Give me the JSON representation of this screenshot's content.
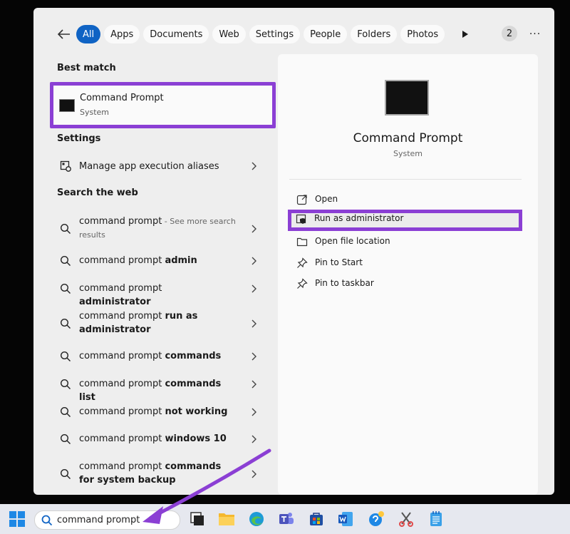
{
  "tabs": [
    "All",
    "Apps",
    "Documents",
    "Web",
    "Settings",
    "People",
    "Folders",
    "Photos"
  ],
  "results_count": "2",
  "more_label": "···",
  "best_match": {
    "heading": "Best match",
    "title": "Command Prompt",
    "subtitle": "System"
  },
  "settings": {
    "heading": "Settings",
    "item": "Manage app execution aliases"
  },
  "web": {
    "heading": "Search the web",
    "items": [
      {
        "base": "command prompt",
        "bold": "",
        "hint": " - See more search results"
      },
      {
        "base": "command prompt ",
        "bold": "admin",
        "hint": ""
      },
      {
        "base": "command prompt ",
        "bold": "administrator",
        "hint": ""
      },
      {
        "base": "command prompt ",
        "bold": "run as administrator",
        "hint": ""
      },
      {
        "base": "command prompt ",
        "bold": "commands",
        "hint": ""
      },
      {
        "base": "command prompt ",
        "bold": "commands list",
        "hint": ""
      },
      {
        "base": "command prompt ",
        "bold": "not working",
        "hint": ""
      },
      {
        "base": "command prompt ",
        "bold": "windows 10",
        "hint": ""
      },
      {
        "base": "command prompt ",
        "bold": "commands for system backup",
        "hint": ""
      }
    ]
  },
  "detail": {
    "title": "Command Prompt",
    "subtitle": "System",
    "actions": [
      "Open",
      "Run as administrator",
      "Open file location",
      "Pin to Start",
      "Pin to taskbar"
    ]
  },
  "taskbar": {
    "search_value": "command prompt"
  },
  "colors": {
    "accent": "#0f63c4",
    "highlight": "#8b3fd4"
  }
}
